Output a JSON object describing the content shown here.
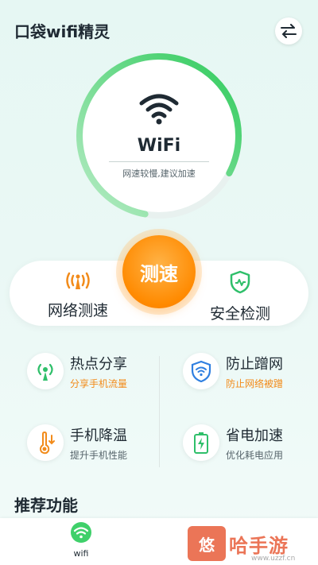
{
  "header": {
    "title": "口袋wifi精灵"
  },
  "icons": {
    "switch": "swap-arrows-icon",
    "wifi": "wifi-icon",
    "speed": "signal-waves-icon",
    "security": "shield-check-icon"
  },
  "gauge": {
    "label": "WiFi",
    "subtitle": "网速较慢,建议加速",
    "progress_percent": 80
  },
  "speed_button": {
    "label": "测速"
  },
  "actions": {
    "left_label": "网络测速",
    "right_label": "安全检测"
  },
  "features": [
    {
      "title": "热点分享",
      "subtitle": "分享手机流量",
      "icon": "hotspot-icon"
    },
    {
      "title": "防止蹭网",
      "subtitle": "防止网络被蹭",
      "icon": "wifi-shield-icon"
    },
    {
      "title": "手机降温",
      "subtitle": "提升手机性能",
      "icon": "thermometer-icon"
    },
    {
      "title": "省电加速",
      "subtitle": "优化耗电应用",
      "icon": "battery-icon"
    }
  ],
  "section": {
    "title": "推荐功能"
  },
  "nav": {
    "wifi_label": "wifi"
  },
  "watermark": {
    "logo": "悠",
    "text": "哈手游",
    "url": "www.uzzf.cn"
  },
  "colors": {
    "accent_green": "#3fd06a",
    "accent_orange": "#ff8a00",
    "text_dark": "#1f2a33"
  }
}
